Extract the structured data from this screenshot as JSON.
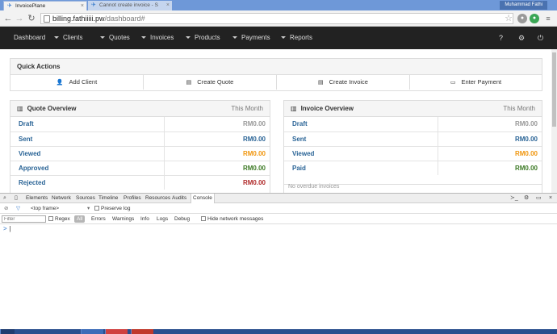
{
  "browser": {
    "tabs": [
      {
        "title": "InvoicePlane",
        "active": true
      },
      {
        "title": "Cannot create invoice - S",
        "active": false
      }
    ],
    "user": "Muhammad Fathi",
    "url_host": "billing.fathiiiii.pw",
    "url_path": "/dashboard#"
  },
  "app_nav": {
    "items": [
      "Dashboard",
      "Clients",
      "Quotes",
      "Invoices",
      "Products",
      "Payments",
      "Reports"
    ]
  },
  "quick_actions": {
    "title": "Quick Actions",
    "items": [
      "Add Client",
      "Create Quote",
      "Create Invoice",
      "Enter Payment"
    ]
  },
  "quote_overview": {
    "title": "Quote Overview",
    "period": "This Month",
    "rows": [
      {
        "label": "Draft",
        "value": "RM0.00",
        "status": "draft"
      },
      {
        "label": "Sent",
        "value": "RM0.00",
        "status": "sent"
      },
      {
        "label": "Viewed",
        "value": "RM0.00",
        "status": "viewed"
      },
      {
        "label": "Approved",
        "value": "RM0.00",
        "status": "approved"
      },
      {
        "label": "Rejected",
        "value": "RM0.00",
        "status": "rejected"
      }
    ]
  },
  "invoice_overview": {
    "title": "Invoice Overview",
    "period": "This Month",
    "rows": [
      {
        "label": "Draft",
        "value": "RM0.00",
        "status": "draft"
      },
      {
        "label": "Sent",
        "value": "RM0.00",
        "status": "sent"
      },
      {
        "label": "Viewed",
        "value": "RM0.00",
        "status": "viewed"
      },
      {
        "label": "Paid",
        "value": "RM0.00",
        "status": "paid"
      }
    ],
    "partial_text": "No overdue invoices"
  },
  "devtools": {
    "tabs": [
      "Elements",
      "Network",
      "Sources",
      "Timeline",
      "Profiles",
      "Resources",
      "Audits",
      "Console"
    ],
    "active_tab": "Console",
    "frame": "<top frame>",
    "preserve_log": "Preserve log",
    "filter_placeholder": "Filter",
    "regex": "Regex",
    "levels": [
      "All",
      "Errors",
      "Warnings",
      "Info",
      "Logs",
      "Debug"
    ],
    "hide_network": "Hide network messages",
    "prompt": ">"
  },
  "colors": {
    "navbar": "#222222",
    "link": "#2a6496",
    "viewed": "#f0960e",
    "approved": "#3d7a25",
    "rejected": "#b02a2a"
  }
}
